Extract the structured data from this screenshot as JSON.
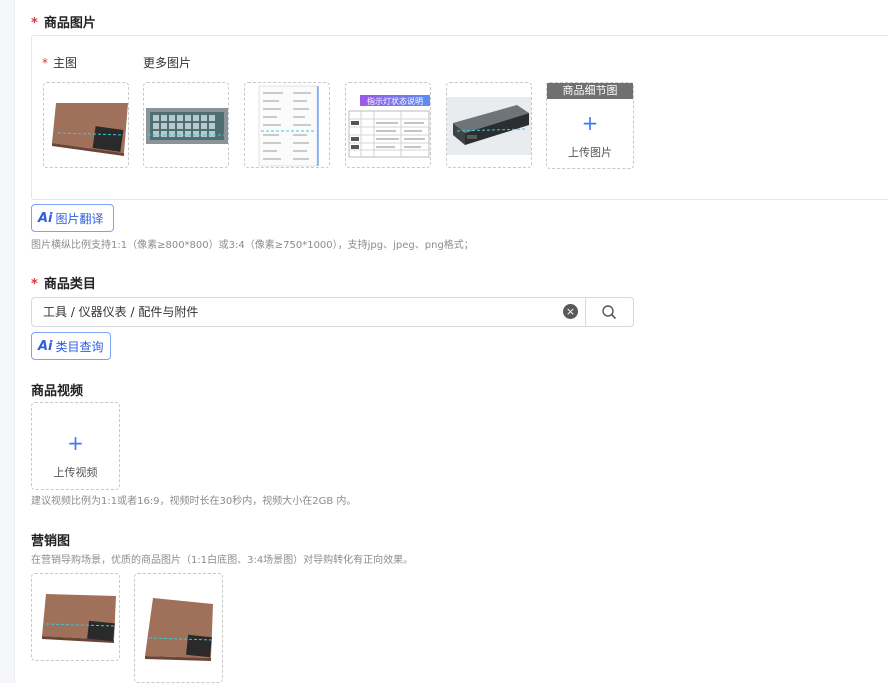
{
  "product_images": {
    "title": "商品图片",
    "required_mark": "*",
    "main_label": "主图",
    "more_label": "更多图片",
    "detail_header": "商品细节图",
    "upload_label": "上传图片",
    "plus": "+",
    "translate_ai": "Ai",
    "translate_label": "图片翻译",
    "hint": "图片横纵比例支持1:1（像素≥800*800）或3:4（像素≥750*1000），支持jpg、jpeg、png格式；",
    "thumb_banner": "指示灯状态说明"
  },
  "category": {
    "title": "商品类目",
    "required_mark": "*",
    "value": "工具 / 仪器仪表 / 配件与附件",
    "clear_glyph": "×",
    "query_ai": "Ai",
    "query_label": "类目查询"
  },
  "video": {
    "title": "商品视频",
    "plus": "+",
    "upload_label": "上传视频",
    "hint": "建议视频比例为1:1或者16:9，视频时长在30秒内，视频大小在2GB 内。"
  },
  "marketing": {
    "title": "营销图",
    "hint": "在营销导购场景，优质的商品图片（1:1白底图、3:4场景图）对导购转化有正向效果。"
  },
  "colors": {
    "accent": "#3a7bf5",
    "required": "#d9363e",
    "border_dashed": "#c8c8c8"
  }
}
